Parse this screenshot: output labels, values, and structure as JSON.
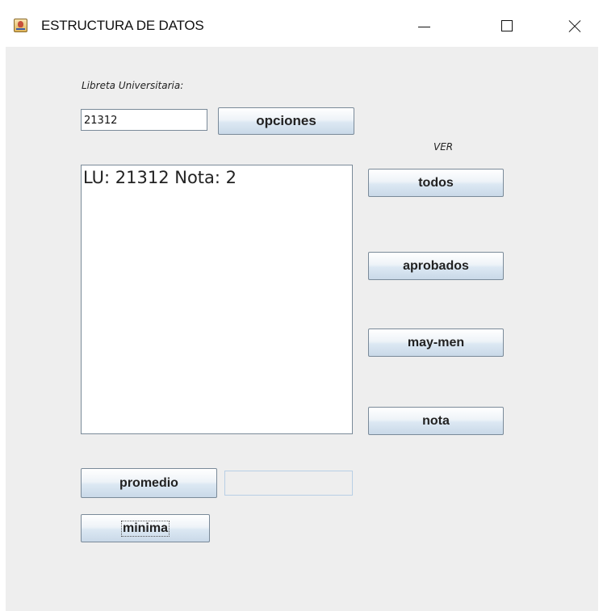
{
  "window": {
    "title": "ESTRUCTURA DE DATOS",
    "icon": "java-cup-icon",
    "controls": [
      "minimize-icon",
      "maximize-icon",
      "close-icon"
    ]
  },
  "form": {
    "lu_label": "Libreta Universitaria:",
    "lu_value": "21312",
    "opciones_label": "opciones",
    "ver_label": "VER",
    "output_text": "LU: 21312 Nota: 2",
    "buttons": {
      "todos": "todos",
      "aprobados": "aprobados",
      "maymen": "may-men",
      "nota": "nota",
      "promedio": "promedio",
      "minima": "minima"
    },
    "promedio_value": ""
  }
}
